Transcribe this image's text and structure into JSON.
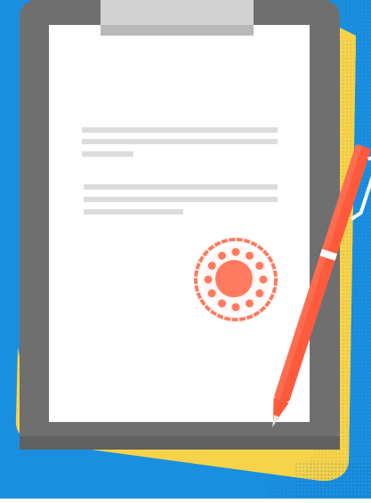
{
  "illustration": {
    "subject": "clipboard-with-stamped-document-and-pen",
    "document": {
      "paragraphs": [
        {
          "lines": 3
        },
        {
          "lines": 3
        }
      ]
    },
    "stamp": {
      "dots": 12
    },
    "icons": [
      "clipboard-icon",
      "document-icon",
      "stamp-icon",
      "pen-icon",
      "folder-icon"
    ],
    "colors": {
      "background": "#1a8fe0",
      "folder": "#f7d34a",
      "clipboard": "#6f6f6f",
      "clip": "#d2d2d2",
      "paper": "#ffffff",
      "text_lines": "#dcdcdc",
      "stamp": "#ff7a5f",
      "pen": "#ff5a3c"
    }
  }
}
